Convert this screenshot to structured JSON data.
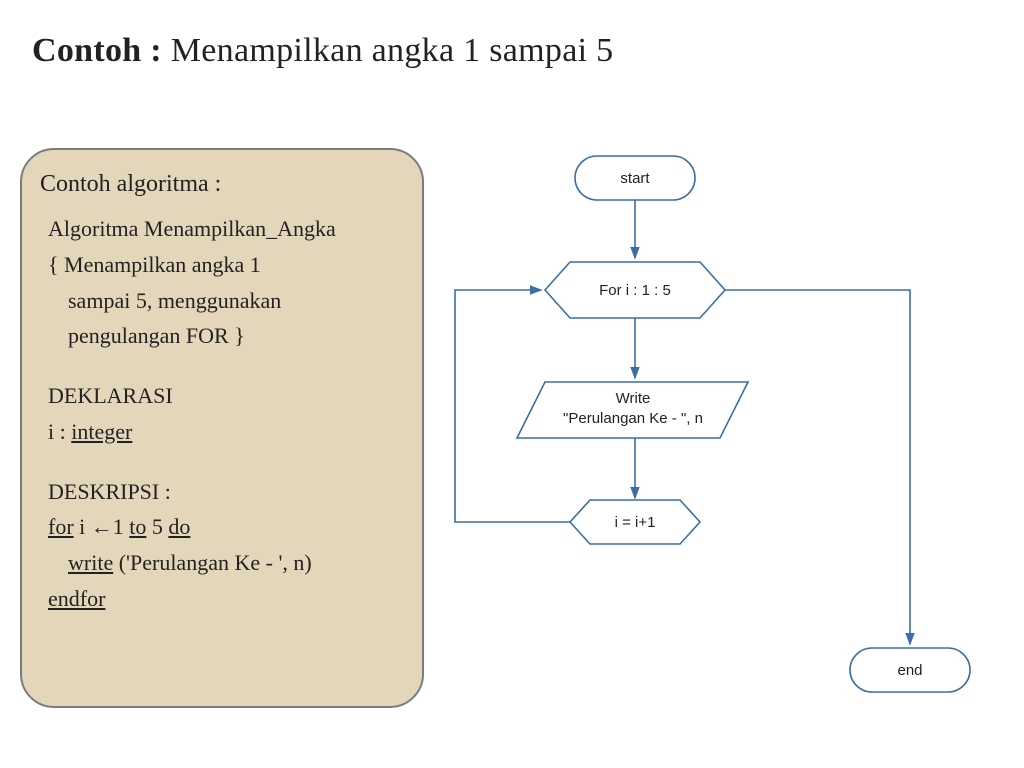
{
  "title": {
    "bold": "Contoh :",
    "rest": " Menampilkan angka 1 sampai 5"
  },
  "algo": {
    "header": "Contoh algoritma :",
    "name": "Algoritma Menampilkan_Angka",
    "desc_l1": "{  Menampilkan angka 1",
    "desc_l2": "sampai 5,   menggunakan",
    "desc_l3": "pengulangan FOR }",
    "dek_h": "DEKLARASI",
    "dek_1a": "i : ",
    "dek_1b": "integer",
    "desk_h": "DESKRIPSI :",
    "for_1a": "for",
    "for_1b": " i ←1 ",
    "for_1c": "to",
    "for_1d": " 5 ",
    "for_1e": "do",
    "write_a": "write",
    "write_b": " ('Perulangan Ke - ', n)",
    "endfor": "endfor"
  },
  "flow": {
    "start": "start",
    "for": "For i : 1 : 5",
    "write_l1": "Write",
    "write_l2": "\"Perulangan Ke - \", n",
    "inc": "i = i+1",
    "end": "end"
  },
  "chart_data": {
    "type": "flowchart",
    "title": "Menampilkan angka 1 sampai 5",
    "nodes": [
      {
        "id": "start",
        "shape": "terminator",
        "label": "start"
      },
      {
        "id": "for",
        "shape": "preparation",
        "label": "For i : 1 : 5"
      },
      {
        "id": "write",
        "shape": "io",
        "label": "Write \"Perulangan Ke - \", n"
      },
      {
        "id": "inc",
        "shape": "preparation",
        "label": "i = i+1"
      },
      {
        "id": "end",
        "shape": "terminator",
        "label": "end"
      }
    ],
    "edges": [
      {
        "from": "start",
        "to": "for"
      },
      {
        "from": "for",
        "to": "write"
      },
      {
        "from": "write",
        "to": "inc"
      },
      {
        "from": "inc",
        "to": "for",
        "kind": "loop-back"
      },
      {
        "from": "for",
        "to": "end",
        "kind": "exit"
      }
    ]
  }
}
